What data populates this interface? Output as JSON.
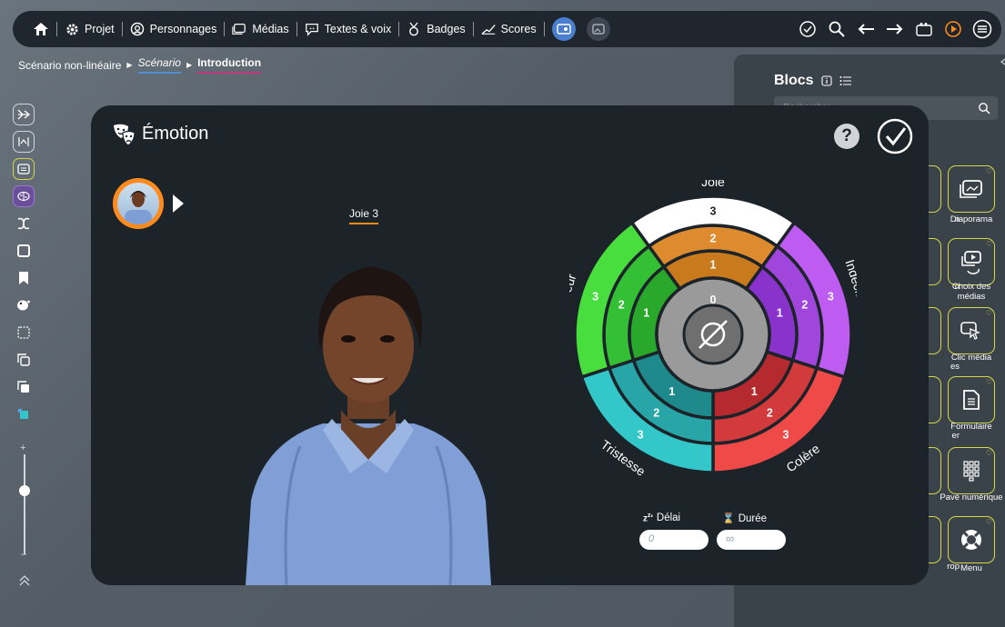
{
  "toolbar": {
    "items": [
      {
        "label": "Projet",
        "icon": "gear-icon"
      },
      {
        "label": "Personnages",
        "icon": "character-icon"
      },
      {
        "label": "Médias",
        "icon": "media-icon"
      },
      {
        "label": "Textes & voix",
        "icon": "speech-icon"
      },
      {
        "label": "Badges",
        "icon": "badge-icon"
      },
      {
        "label": "Scores",
        "icon": "scores-icon"
      }
    ]
  },
  "breadcrumb": {
    "root": "Scénario non-linéaire",
    "level2": "Scénario",
    "level3": "Introduction"
  },
  "panel": {
    "title": "Blocs",
    "search_placeholder": "Rechercher",
    "tiles": [
      {
        "label": "Diaporama"
      },
      {
        "label": "Choix des médias"
      },
      {
        "label": "Clic média"
      },
      {
        "label": "Formulaire"
      },
      {
        "label": "Pavé numérique"
      },
      {
        "label": "Menu"
      }
    ],
    "partial_labels": [
      "n",
      "n",
      "es",
      "er",
      "",
      "rop"
    ]
  },
  "dialog": {
    "title": "Émotion",
    "help": "?",
    "selected_emotion": "Joie 3",
    "delay_label": "Délai",
    "delay_value": "0",
    "duration_label": "Durée",
    "duration_value": "∞"
  },
  "wheel": {
    "center_value": "0",
    "emotions": [
      {
        "name": "Joie",
        "levels": [
          "1",
          "2",
          "3"
        ],
        "colors": [
          "#c97a1c",
          "#de8a2e",
          "#ffffff"
        ]
      },
      {
        "name": "Indécision",
        "levels": [
          "1",
          "2",
          "3"
        ],
        "colors": [
          "#8a32cc",
          "#a046dc",
          "#be5bf0"
        ]
      },
      {
        "name": "Colère",
        "levels": [
          "1",
          "2",
          "3"
        ],
        "colors": [
          "#b52a2e",
          "#d23a3c",
          "#ef4a48"
        ]
      },
      {
        "name": "Tristesse",
        "levels": [
          "1",
          "2",
          "3"
        ],
        "colors": [
          "#1f8a8c",
          "#27a5a7",
          "#33c7c9"
        ]
      },
      {
        "name": "Peur",
        "levels": [
          "1",
          "2",
          "3"
        ],
        "colors": [
          "#2aa82c",
          "#34c035",
          "#48de3e"
        ]
      }
    ],
    "selected_index": 0,
    "selected_level": 3
  },
  "colors": {
    "accent_orange": "#ff8a1d",
    "dialog_bg": "#1c2329",
    "tile_border": "#d7d64a"
  }
}
